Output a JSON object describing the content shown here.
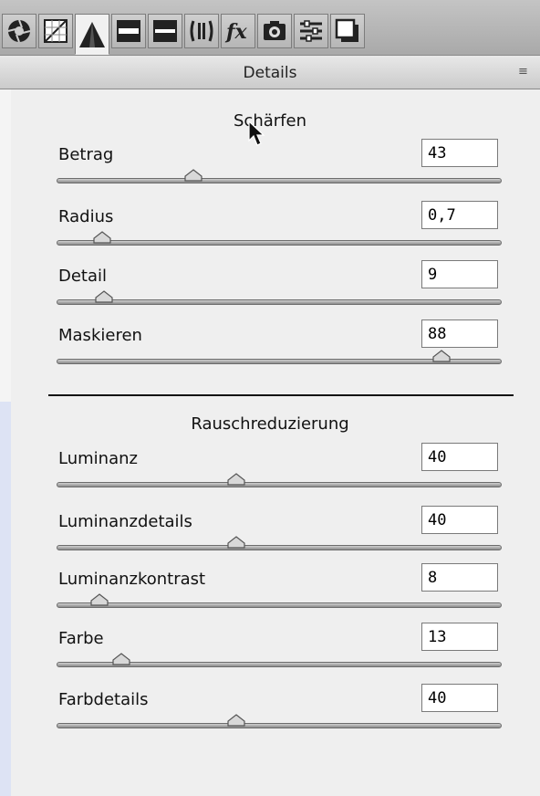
{
  "toolbar": {
    "tabs": [
      {
        "icon": "aperture-icon"
      },
      {
        "icon": "tone-curve-icon"
      },
      {
        "icon": "detail-triangle-icon",
        "active": true
      },
      {
        "icon": "hsl-grayscale-icon"
      },
      {
        "icon": "split-toning-icon"
      },
      {
        "icon": "lens-corrections-icon"
      },
      {
        "icon": "fx-icon"
      },
      {
        "icon": "camera-calibration-icon"
      },
      {
        "icon": "presets-icon"
      },
      {
        "icon": "snapshots-icon"
      }
    ]
  },
  "panel": {
    "title": "Details",
    "menu_icon": "≡"
  },
  "sharpening": {
    "title": "Schärfen",
    "controls": [
      {
        "label": "Betrag",
        "value": "43",
        "fraction": 0.3
      },
      {
        "label": "Radius",
        "value": "0,7",
        "fraction": 0.085
      },
      {
        "label": "Detail",
        "value": "9",
        "fraction": 0.09
      },
      {
        "label": "Maskieren",
        "value": "88",
        "fraction": 0.88
      }
    ]
  },
  "noise": {
    "title": "Rauschreduzierung",
    "controls": [
      {
        "label": "Luminanz",
        "value": "40",
        "fraction": 0.4
      },
      {
        "label": "Luminanzdetails",
        "value": "40",
        "fraction": 0.4
      },
      {
        "label": "Luminanzkontrast",
        "value": "8",
        "fraction": 0.08
      },
      {
        "label": "Farbe",
        "value": "13",
        "fraction": 0.13
      },
      {
        "label": "Farbdetails",
        "value": "40",
        "fraction": 0.4
      }
    ]
  }
}
